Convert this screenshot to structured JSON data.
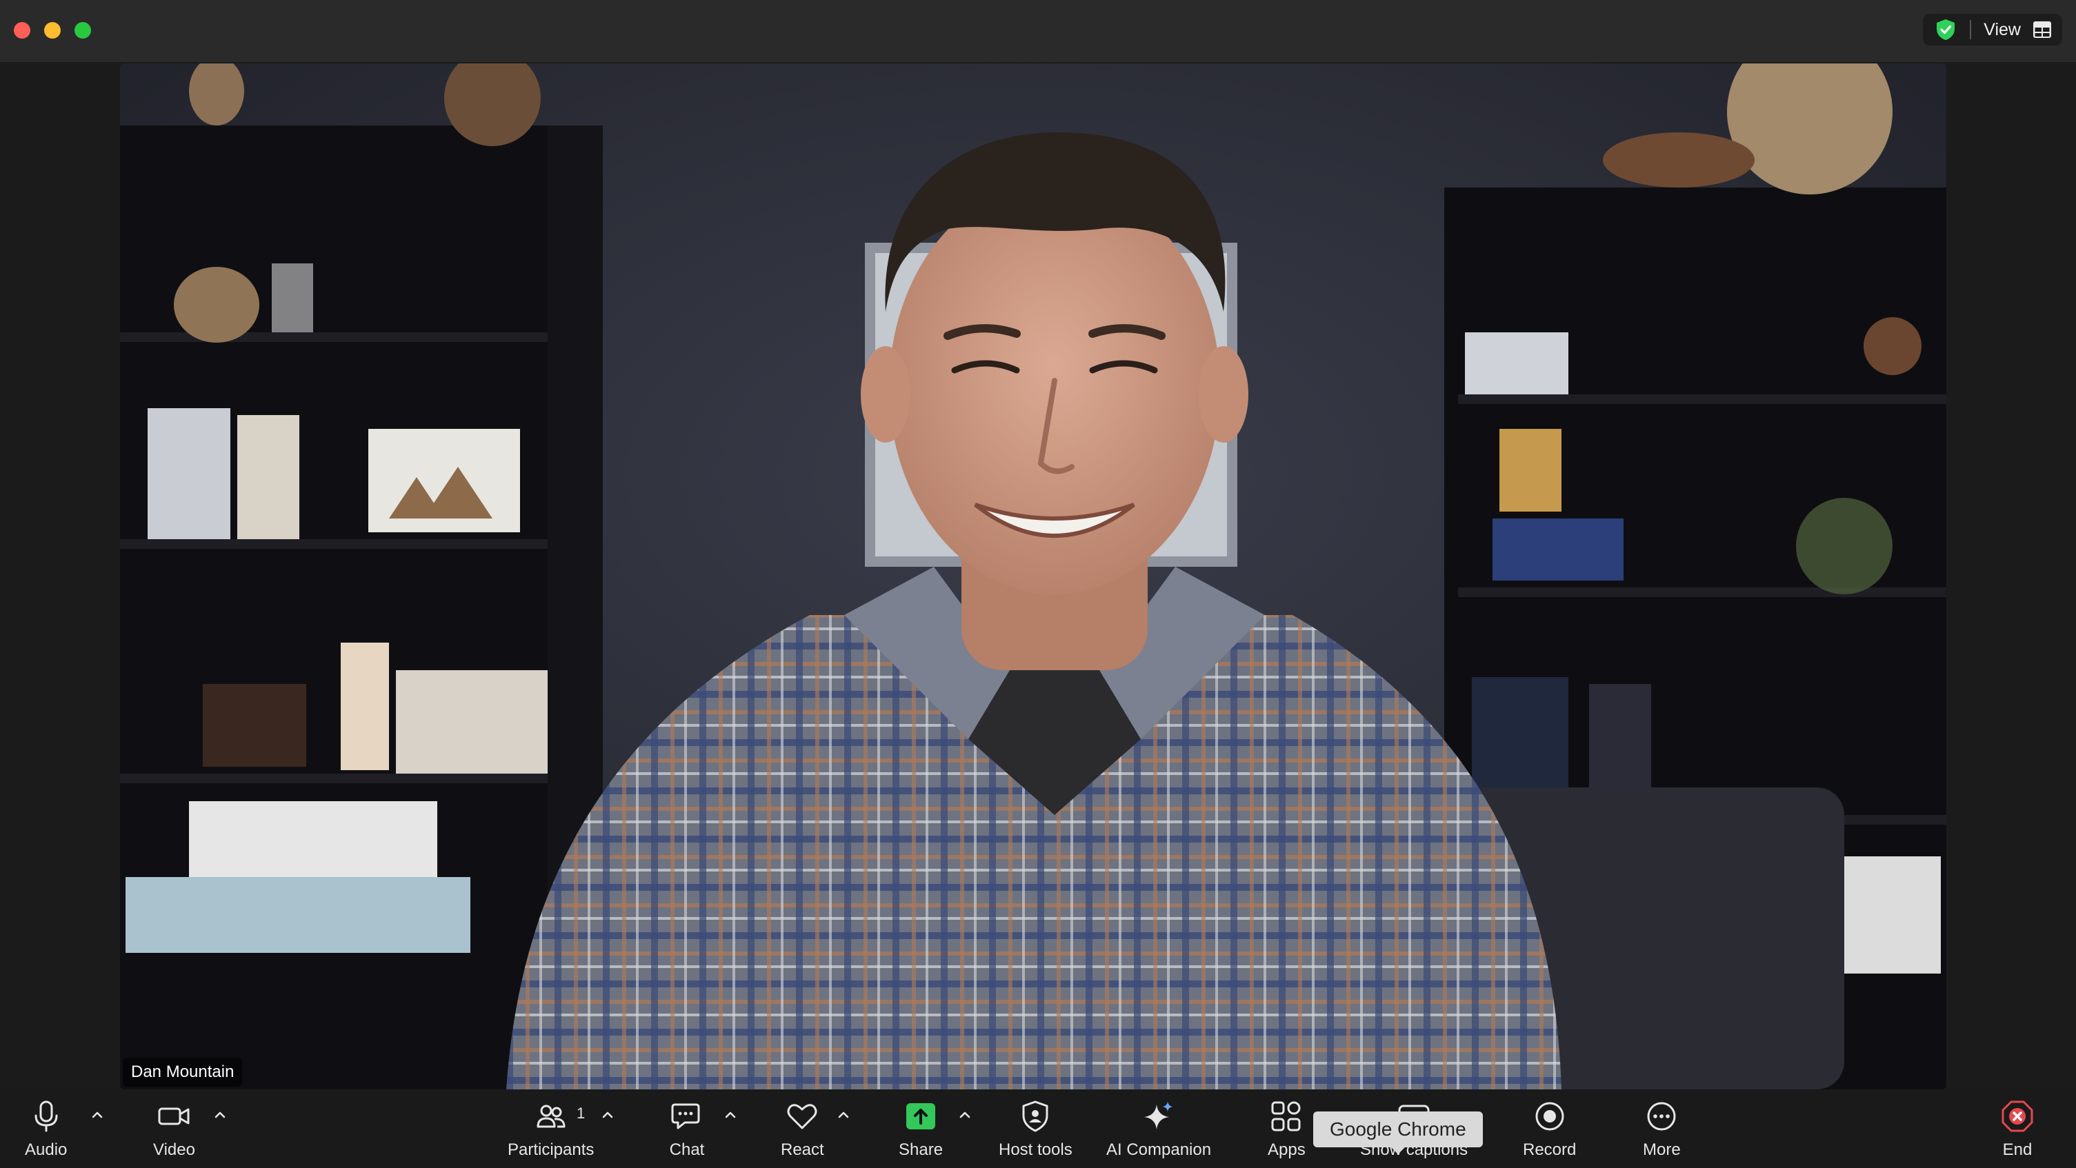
{
  "titlebar": {
    "view_label": "View",
    "icons": [
      "security-shield-icon",
      "grid-view-icon"
    ]
  },
  "video": {
    "participant_name": "Dan Mountain"
  },
  "toolbar": {
    "audio_label": "Audio",
    "video_label": "Video",
    "participants_label": "Participants",
    "participants_count": "1",
    "chat_label": "Chat",
    "react_label": "React",
    "share_label": "Share",
    "host_tools_label": "Host tools",
    "ai_companion_label": "AI Companion",
    "apps_label": "Apps",
    "captions_label": "Show captions",
    "record_label": "Record",
    "more_label": "More",
    "end_label": "End"
  },
  "tooltip": {
    "text": "Google Chrome"
  },
  "colors": {
    "share_green": "#34c759",
    "end_red": "#e5484d",
    "shield_green": "#2fd158",
    "toolbar_bg": "#1a1a1a"
  }
}
